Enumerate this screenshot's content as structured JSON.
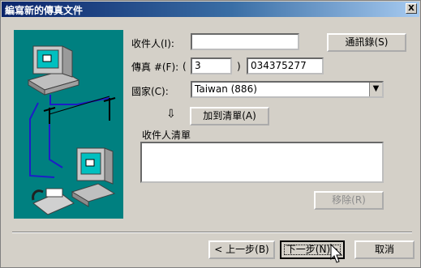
{
  "window": {
    "title": "編寫新的傳真文件",
    "close_label": "X"
  },
  "form": {
    "recipient_label": "收件人(I):",
    "recipient_value": "",
    "address_book_label": "通訊錄(S)",
    "fax_label": "傳真 #(F):",
    "area_open_paren": "(",
    "area_code_value": "3",
    "area_close_paren": ")",
    "fax_number_value": "034375277",
    "country_label": "國家(C):",
    "country_value": "Taiwan (886)",
    "add_to_list_label": "加到清單(A)",
    "recipient_list_label": "收件人清單",
    "remove_label": "移除(R)"
  },
  "footer": {
    "back_label": "< 上一步(B)",
    "next_label": "下一步(N)>",
    "cancel_label": "取消"
  },
  "colors": {
    "illustration_bg": "#008080",
    "dialog_bg": "#d4d0c8",
    "title_start": "#0a246a"
  }
}
